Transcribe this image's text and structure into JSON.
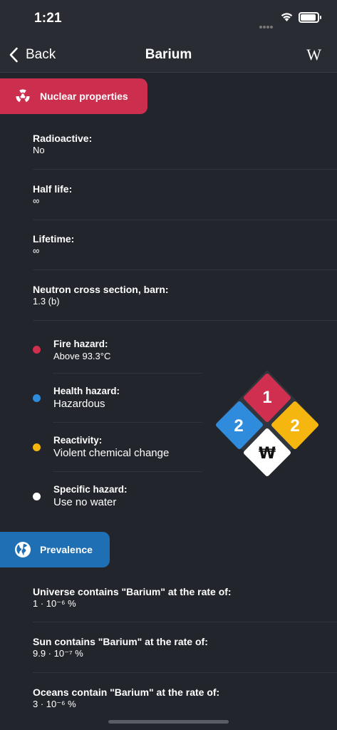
{
  "status": {
    "time": "1:21"
  },
  "nav": {
    "back_label": "Back",
    "title": "Barium",
    "wiki_label": "W"
  },
  "nuclear": {
    "title": "Nuclear properties",
    "items": [
      {
        "label": "Radioactive:",
        "value": "No"
      },
      {
        "label": "Half life:",
        "value": "∞"
      },
      {
        "label": "Lifetime:",
        "value": "∞"
      },
      {
        "label": "Neutron cross section, barn:",
        "value": "1.3 (b)"
      }
    ]
  },
  "hazards": {
    "items": [
      {
        "label": "Fire hazard:",
        "value": "Above 93.3°C",
        "color": "#d12f4f"
      },
      {
        "label": "Health hazard:",
        "value": "Hazardous",
        "color": "#2f8bdb"
      },
      {
        "label": "Reactivity:",
        "value": "Violent chemical change",
        "color": "#f5b70f"
      },
      {
        "label": "Specific hazard:",
        "value": "Use no water",
        "color": "#ffffff"
      }
    ],
    "diamond": {
      "fire": "1",
      "health": "2",
      "reactivity": "2",
      "special": "₩"
    }
  },
  "prevalence": {
    "title": "Prevalence",
    "items": [
      {
        "label": "Universe contains \"Barium\" at the rate of:",
        "value": "1 · 10⁻⁶ %"
      },
      {
        "label": "Sun contains \"Barium\" at the rate of:",
        "value": "9.9 · 10⁻⁷ %"
      },
      {
        "label": "Oceans contain \"Barium\" at the rate of:",
        "value": "3 · 10⁻⁶ %"
      }
    ]
  }
}
